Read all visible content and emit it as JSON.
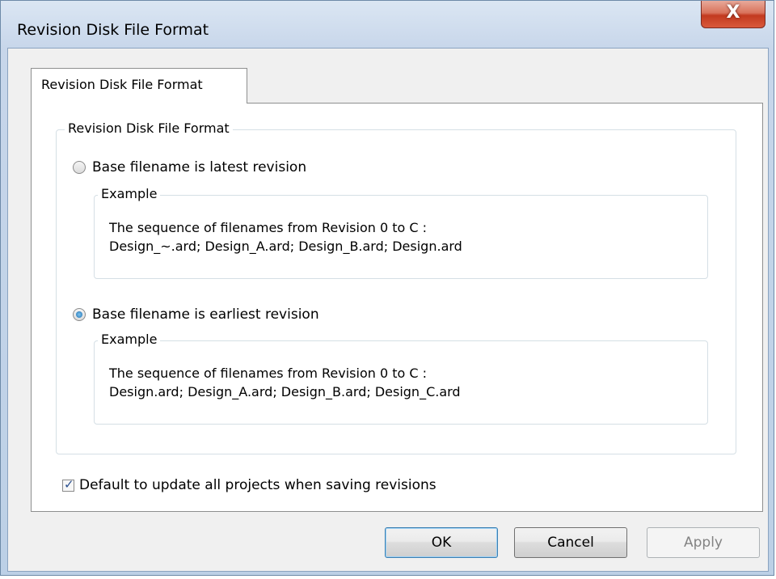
{
  "window": {
    "title": "Revision Disk File Format",
    "close_label": "X"
  },
  "tab": {
    "label": "Revision Disk File Format"
  },
  "group": {
    "label": "Revision Disk File Format",
    "option_latest": {
      "label": "Base filename is latest revision",
      "checked": false,
      "example_label": "Example",
      "example_line1": "The sequence of filenames from Revision 0 to C :",
      "example_line2": "Design_~.ard; Design_A.ard; Design_B.ard; Design.ard"
    },
    "option_earliest": {
      "label": "Base filename is earliest revision",
      "checked": true,
      "example_label": "Example",
      "example_line1": "The sequence of filenames from Revision 0 to C :",
      "example_line2": "Design.ard; Design_A.ard; Design_B.ard; Design_C.ard"
    }
  },
  "default_update": {
    "label": "Default to update all projects when saving revisions",
    "checked": true
  },
  "buttons": {
    "ok": "OK",
    "cancel": "Cancel",
    "apply": "Apply"
  }
}
